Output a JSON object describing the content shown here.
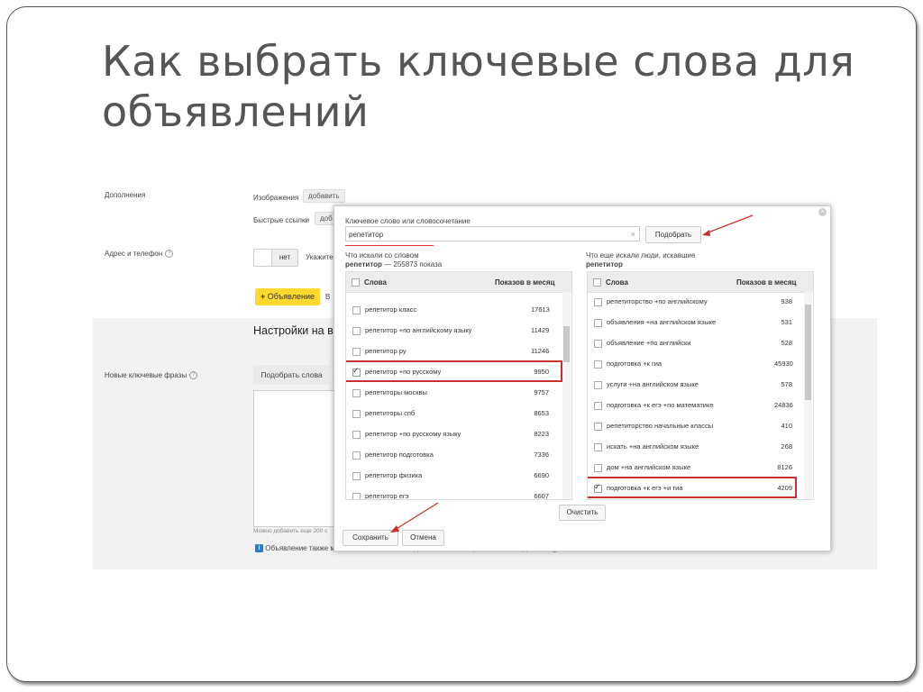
{
  "slide": {
    "title": "Как выбрать ключевые слова для объявлений"
  },
  "form": {
    "additions_label": "Дополнения",
    "images_label": "Изображения",
    "add_label": "добавить",
    "quick_links_label": "Быстрые ссылки",
    "quick_links_add_partial": "доб",
    "address_label": "Адрес и телефон",
    "address_toggle_no": "нет",
    "address_partial": "Укажите",
    "ad_button": "Объявление",
    "ad_button_partial": "В",
    "settings_partial": "Настройки на в",
    "new_phrases_label": "Новые ключевые фразы",
    "pick_words_button": "Подобрать слова",
    "can_add_partial": "Можно добавить еще 200 с",
    "info_note": "Объявление также может быть показано по дополнительным релевантным фразам."
  },
  "dialog": {
    "keyword_label": "Ключевое слово или словосочетание",
    "keyword_value": "репетитор",
    "pick_button": "Подобрать",
    "left_caption_line1": "Что искали со словом",
    "left_caption_word": "репетитор",
    "left_caption_count": "— 255873 показа",
    "right_caption_line1": "Что еще искали люди, искавшие",
    "right_caption_word": "репетитор",
    "col_words": "Слова",
    "col_shows": "Показов в месяц",
    "left_rows": [
      {
        "word": "репетитор класс",
        "count": "17613",
        "checked": false
      },
      {
        "word": "репетитор +по английскому языку",
        "count": "11429",
        "checked": false
      },
      {
        "word": "репетитор ру",
        "count": "11246",
        "checked": false
      },
      {
        "word": "репетитор +по русскому",
        "count": "9950",
        "checked": true
      },
      {
        "word": "репетиторы москвы",
        "count": "9757",
        "checked": false
      },
      {
        "word": "репетиторы спб",
        "count": "8653",
        "checked": false
      },
      {
        "word": "репетитор +по русскому языку",
        "count": "8223",
        "checked": false
      },
      {
        "word": "репетитор подготовка",
        "count": "7336",
        "checked": false
      },
      {
        "word": "репетитор физика",
        "count": "6690",
        "checked": false
      },
      {
        "word": "репетитор егэ",
        "count": "6607",
        "checked": false
      }
    ],
    "right_rows": [
      {
        "word": "репетиторство +по английскому",
        "count": "938",
        "checked": false
      },
      {
        "word": "объявления +на английском языке",
        "count": "531",
        "checked": false
      },
      {
        "word": "объявление +по английски",
        "count": "528",
        "checked": false
      },
      {
        "word": "подготовка +к гиа",
        "count": "45930",
        "checked": false
      },
      {
        "word": "услуги +на английском языке",
        "count": "578",
        "checked": false
      },
      {
        "word": "подготовка +к егэ +по математике",
        "count": "24836",
        "checked": false
      },
      {
        "word": "репетиторство начальные классы",
        "count": "410",
        "checked": false
      },
      {
        "word": "искать +на английском языке",
        "count": "268",
        "checked": false
      },
      {
        "word": "дом +на английском языке",
        "count": "8126",
        "checked": false
      },
      {
        "word": "подготовка +к егэ +и гиа",
        "count": "4209",
        "checked": true
      }
    ],
    "clear_button": "Очистить",
    "save_button": "Сохранить",
    "cancel_button": "Отмена"
  },
  "colors": {
    "highlight": "#c9302c",
    "yellow_button": "#ffd92e",
    "info_icon": "#2d7bd1"
  }
}
